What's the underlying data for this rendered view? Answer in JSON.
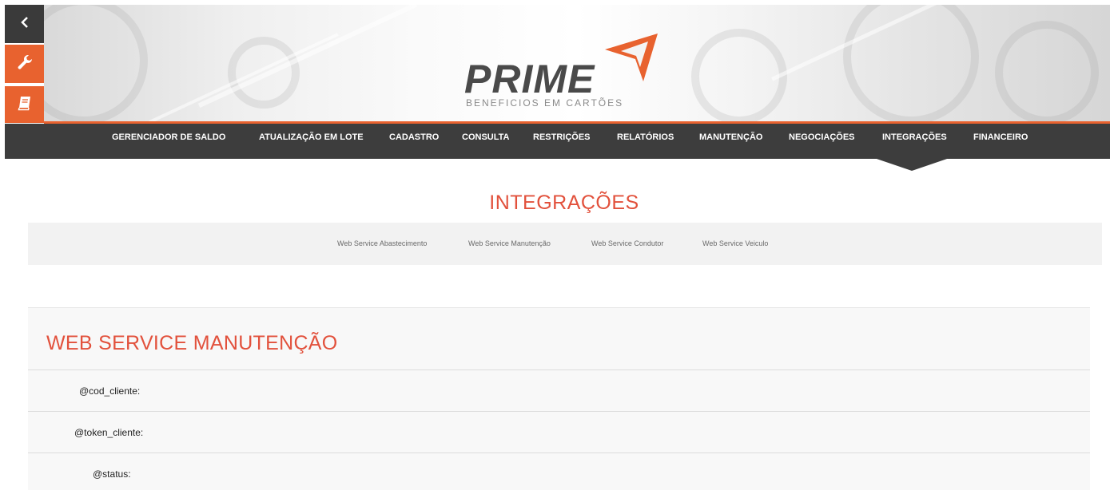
{
  "sidebar": {
    "back": "chevron-left-icon",
    "tools": "wrench-icon",
    "manual": "book-icon"
  },
  "header": {
    "logo_text": "PRIME",
    "logo_tagline": "BENEFICIOS EM CARTÕES"
  },
  "colors": {
    "accent": "#e8622f",
    "title_red": "#e2513c",
    "nav_bg": "#3d3d3d"
  },
  "nav": {
    "items": [
      {
        "label": "GERENCIADOR DE SALDO"
      },
      {
        "label": "ATUALIZAÇÃO EM LOTE"
      },
      {
        "label": "CADASTRO"
      },
      {
        "label": "CONSULTA"
      },
      {
        "label": "RESTRIÇÕES"
      },
      {
        "label": "RELATÓRIOS"
      },
      {
        "label": "MANUTENÇÃO"
      },
      {
        "label": "NEGOCIAÇÕES"
      },
      {
        "label": "INTEGRAÇÕES",
        "active": true
      },
      {
        "label": "FINANCEIRO"
      }
    ]
  },
  "page": {
    "title": "INTEGRAÇÕES"
  },
  "subnav": {
    "items": [
      {
        "label": "Web Service Abastecimento"
      },
      {
        "label": "Web Service Manutenção"
      },
      {
        "label": "Web Service Condutor"
      },
      {
        "label": "Web Service Veiculo"
      }
    ]
  },
  "panel": {
    "title": "WEB SERVICE MANUTENÇÃO",
    "fields": [
      {
        "label": "@cod_cliente:"
      },
      {
        "label": "@token_cliente:"
      },
      {
        "label": "@status:"
      }
    ]
  }
}
